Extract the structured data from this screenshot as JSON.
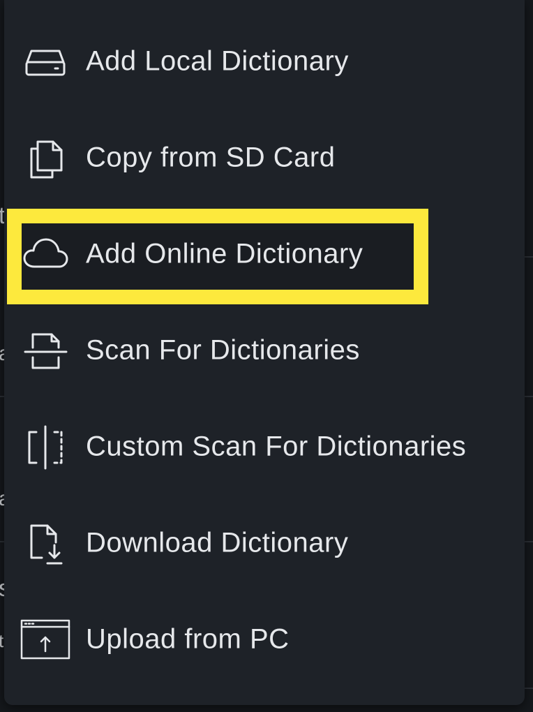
{
  "background": {
    "fragments": [
      {
        "text": "t"
      },
      {
        "text": "a"
      },
      {
        "text": "a"
      },
      {
        "text": "s"
      },
      {
        "text": "t"
      }
    ]
  },
  "menu": {
    "items": [
      {
        "label": "Add Local Dictionary",
        "icon": "drive-icon"
      },
      {
        "label": "Copy from SD Card",
        "icon": "copy-files-icon"
      },
      {
        "label": "Add Online Dictionary",
        "icon": "cloud-icon",
        "highlighted": true
      },
      {
        "label": "Scan For Dictionaries",
        "icon": "scan-document-icon"
      },
      {
        "label": "Custom Scan For Dictionaries",
        "icon": "split-scan-icon"
      },
      {
        "label": "Download Dictionary",
        "icon": "file-download-icon"
      },
      {
        "label": "Upload from PC",
        "icon": "upload-window-icon"
      }
    ]
  },
  "colors": {
    "menu_background": "#1e2228",
    "text": "#e6e8eb",
    "highlight_border": "#fde93d"
  }
}
